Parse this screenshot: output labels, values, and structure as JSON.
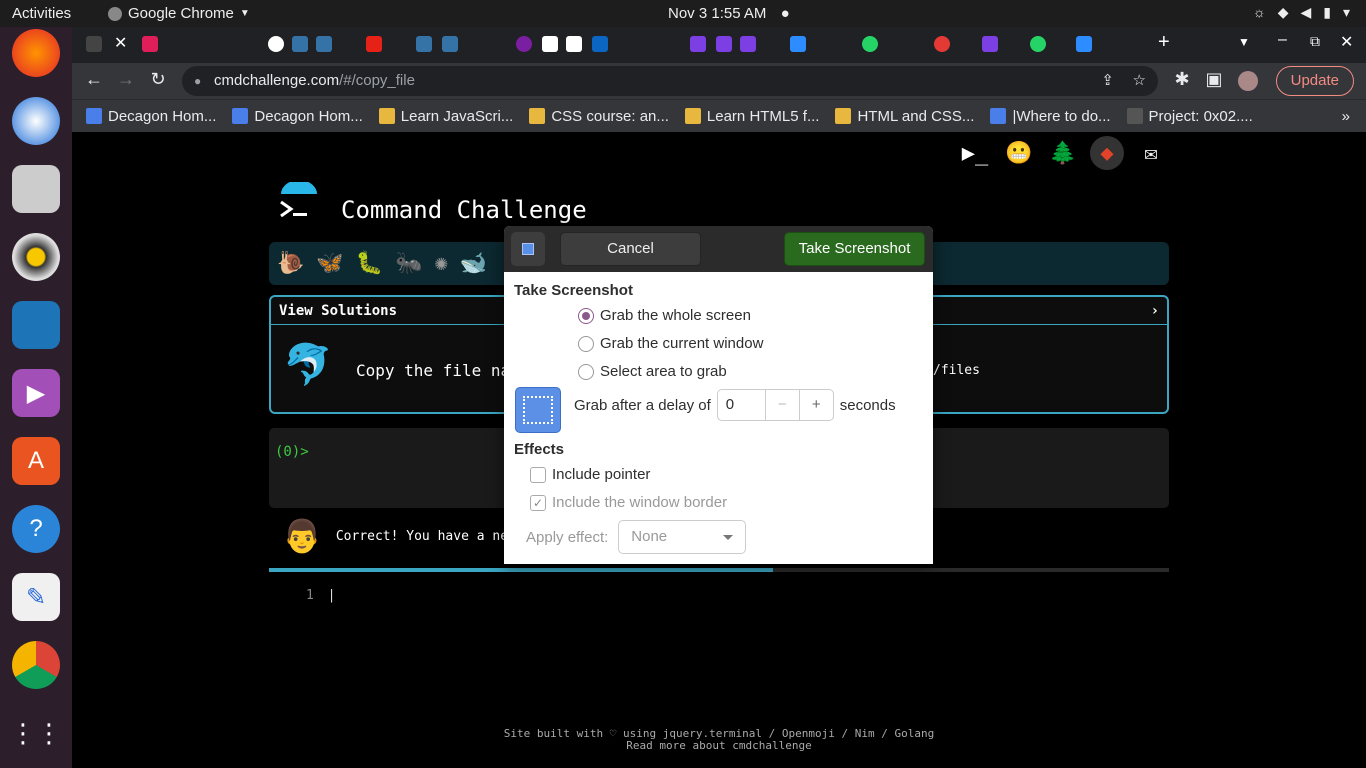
{
  "topbar": {
    "activities": "Activities",
    "app_name": "Google Chrome",
    "clock": "Nov 3  1:55 AM"
  },
  "browser": {
    "url_domain": "cmdchallenge.com",
    "url_path": "/#/copy_file",
    "update_label": "Update",
    "bookmarks": [
      "Decagon Hom...",
      "Decagon Hom...",
      "Learn JavaScri...",
      "CSS course: an...",
      "Learn HTML5 f...",
      "HTML and CSS...",
      "|Where to do...",
      "Project: 0x02...."
    ]
  },
  "page": {
    "title": "Command Challenge",
    "view_solutions": "View Solutions",
    "chevron": "›",
    "description": "Copy the file na",
    "description_tail": "/files",
    "prompt": "(0)>",
    "correct_text": "Correct! You have a ne",
    "editor_line": "1",
    "footer_line1": "Site built with ♡ using jquery.terminal / Openmoji / Nim / Golang",
    "footer_line2": "Read more about cmdchallenge"
  },
  "dialog": {
    "cancel_label": "Cancel",
    "take_label": "Take Screenshot",
    "section_title": "Take Screenshot",
    "options": [
      "Grab the whole screen",
      "Grab the current window",
      "Select area to grab"
    ],
    "delay_label": "Grab after a delay of",
    "delay_value": "0",
    "minus": "−",
    "plus": "+",
    "seconds_label": "seconds",
    "effects_title": "Effects",
    "include_pointer": "Include pointer",
    "include_border": "Include the window border",
    "apply_effect_label": "Apply effect:",
    "apply_effect_value": "None"
  },
  "colors": {
    "accent_green": "#2a6a1e",
    "teal": "#3ba6c2",
    "prompt_green": "#3ec93e"
  }
}
